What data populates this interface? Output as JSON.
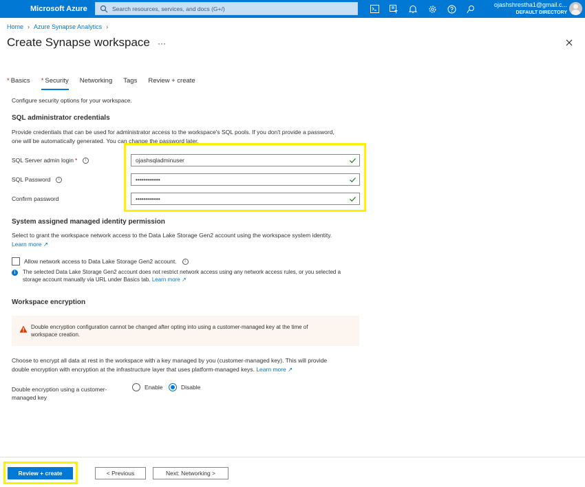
{
  "topbar": {
    "brand": "Microsoft Azure",
    "search_placeholder": "Search resources, services, and docs (G+/)",
    "icons": [
      "cloud-shell-icon",
      "directory-filter-icon",
      "notifications-bell-icon",
      "settings-gear-icon",
      "help-icon",
      "feedback-icon"
    ],
    "account_email": "ojashshrestha1@gmail.c...",
    "account_directory": "DEFAULT DIRECTORY"
  },
  "breadcrumb": [
    "Home",
    "Azure Synapse Analytics"
  ],
  "page_title": "Create Synapse workspace",
  "tabs": [
    {
      "label": "Basics",
      "required": "*",
      "active": false
    },
    {
      "label": "Security",
      "required": "*",
      "active": true
    },
    {
      "label": "Networking",
      "required": "",
      "active": false
    },
    {
      "label": "Tags",
      "required": "",
      "active": false
    },
    {
      "label": "Review + create",
      "required": "",
      "active": false
    }
  ],
  "intro": "Configure security options for your workspace.",
  "sql_admin": {
    "heading": "SQL administrator credentials",
    "description_line1": "Provide credentials that can be used for administrator access to the workspace's SQL pools. If you don't provide a password,",
    "description_line2": "one will be automatically generated. You can change the password later.",
    "login_label": "SQL Server admin login",
    "login_required": "*",
    "login_value": "ojashsqladminuser",
    "password_label": "SQL Password",
    "password_value": "••••••••••••",
    "confirm_label": "Confirm password",
    "confirm_value": "••••••••••••"
  },
  "identity": {
    "heading": "System assigned managed identity permission",
    "description": "Select to grant the workspace network access to the Data Lake Storage Gen2 account using the workspace system identity.",
    "learn_more": "Learn more",
    "checkbox_label": "Allow network access to Data Lake Storage Gen2 account.",
    "checkbox_checked": false,
    "info_line1": "The selected Data Lake Storage Gen2 account does not restrict network access using any network access rules, or you selected a",
    "info_line2": "storage account manually via URL under Basics tab.",
    "info_learn_more": "Learn more"
  },
  "encryption": {
    "heading": "Workspace encryption",
    "warning_line1": "Double encryption configuration cannot be changed after opting into using a customer-managed key at the time of",
    "warning_line2": "workspace creation.",
    "description_line1": "Choose to encrypt all data at rest in the workspace with a key managed by you (customer-managed key). This will provide",
    "description_line2": "double encryption with encryption at the infrastructure layer that uses platform-managed keys.",
    "learn_more": "Learn more",
    "option_label_line1": "Double encryption using a customer-",
    "option_label_line2": "managed key",
    "enable_label": "Enable",
    "disable_label": "Disable",
    "selected": "Disable"
  },
  "footer": {
    "review_create": "Review + create",
    "previous": "< Previous",
    "next": "Next: Networking >"
  },
  "colors": {
    "azure_blue": "#0078d4",
    "highlight_yellow": "#fff200",
    "success_green": "#107c10",
    "warning_orange": "#d83b01"
  }
}
